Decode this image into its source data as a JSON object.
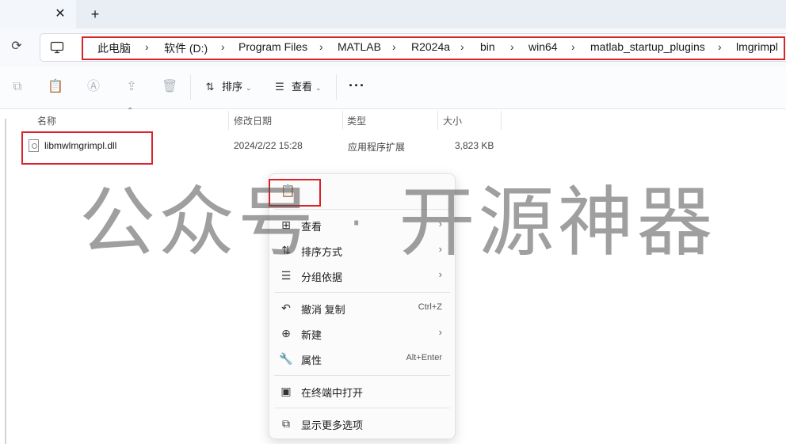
{
  "tabstrip": {
    "close_icon": "close-icon",
    "new_tab_icon": "plus-icon",
    "close_glyph": "✕",
    "new_glyph": "+"
  },
  "addressbar": {
    "crumbs": [
      "此电脑",
      "软件 (D:)",
      "Program Files",
      "MATLAB",
      "R2024a",
      "bin",
      "win64",
      "matlab_startup_plugins",
      "lmgrimpl"
    ],
    "separator": "›",
    "highlight_color": "#d9232a"
  },
  "toolbar": {
    "sort_label": "排序",
    "view_label": "查看",
    "more_label": "···"
  },
  "columns": {
    "name": "名称",
    "modified": "修改日期",
    "type": "类型",
    "size": "大小"
  },
  "files": [
    {
      "name": "libmwlmgrimpl.dll",
      "modified": "2024/2/22 15:28",
      "type": "应用程序扩展",
      "size": "3,823 KB"
    }
  ],
  "watermark": {
    "text": "公众号 · 开源神器"
  },
  "context_menu": {
    "paste_icon": "paste-icon",
    "items": [
      {
        "label": "查看",
        "icon": "grid-icon",
        "arrow": "›"
      },
      {
        "label": "排序方式",
        "icon": "sort-icon",
        "arrow": "›"
      },
      {
        "label": "分组依据",
        "icon": "group-icon",
        "arrow": "›"
      },
      {
        "label": "撤消 复制",
        "icon": "undo-icon",
        "shortcut": "Ctrl+Z"
      },
      {
        "label": "新建",
        "icon": "new-icon",
        "arrow": "›"
      },
      {
        "label": "属性",
        "icon": "properties-icon",
        "shortcut": "Alt+Enter"
      },
      {
        "label": "在终端中打开",
        "icon": "terminal-icon"
      },
      {
        "label": "显示更多选项",
        "icon": "more-options-icon"
      }
    ]
  }
}
